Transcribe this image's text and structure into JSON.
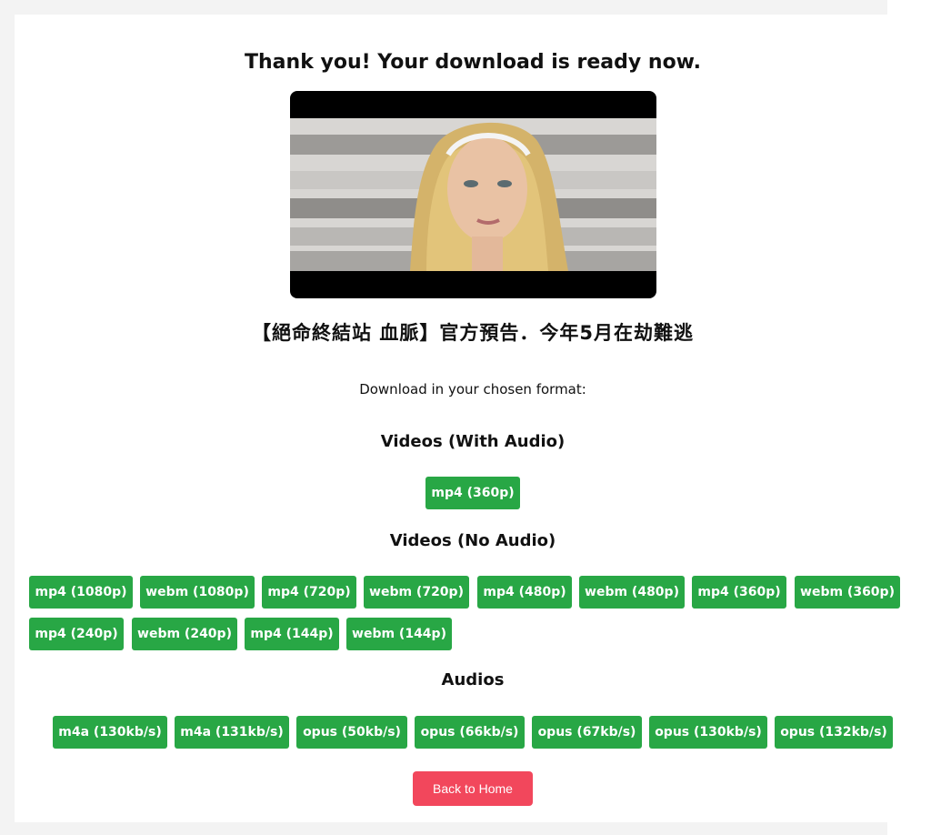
{
  "header": {
    "title": "Thank you! Your download is ready now."
  },
  "video": {
    "title": "【絕命終結站 血脈】官方預告．今年5月在劫難逃"
  },
  "format_prompt": "Download in your chosen format:",
  "sections": {
    "with_audio": {
      "heading": "Videos (With Audio)",
      "buttons": [
        "mp4 (360p)"
      ]
    },
    "no_audio": {
      "heading": "Videos (No Audio)",
      "buttons": [
        "mp4 (1080p)",
        "webm (1080p)",
        "mp4 (720p)",
        "webm (720p)",
        "mp4 (480p)",
        "webm (480p)",
        "mp4 (360p)",
        "webm (360p)",
        "mp4 (240p)",
        "webm (240p)",
        "mp4 (144p)",
        "webm (144p)"
      ]
    },
    "audios": {
      "heading": "Audios",
      "buttons": [
        "m4a (130kb/s)",
        "m4a (131kb/s)",
        "opus (50kb/s)",
        "opus (66kb/s)",
        "opus (67kb/s)",
        "opus (130kb/s)",
        "opus (132kb/s)"
      ]
    }
  },
  "footer": {
    "home_label": "Back to Home"
  },
  "colors": {
    "download_button": "#28a745",
    "home_button": "#f2475c"
  }
}
